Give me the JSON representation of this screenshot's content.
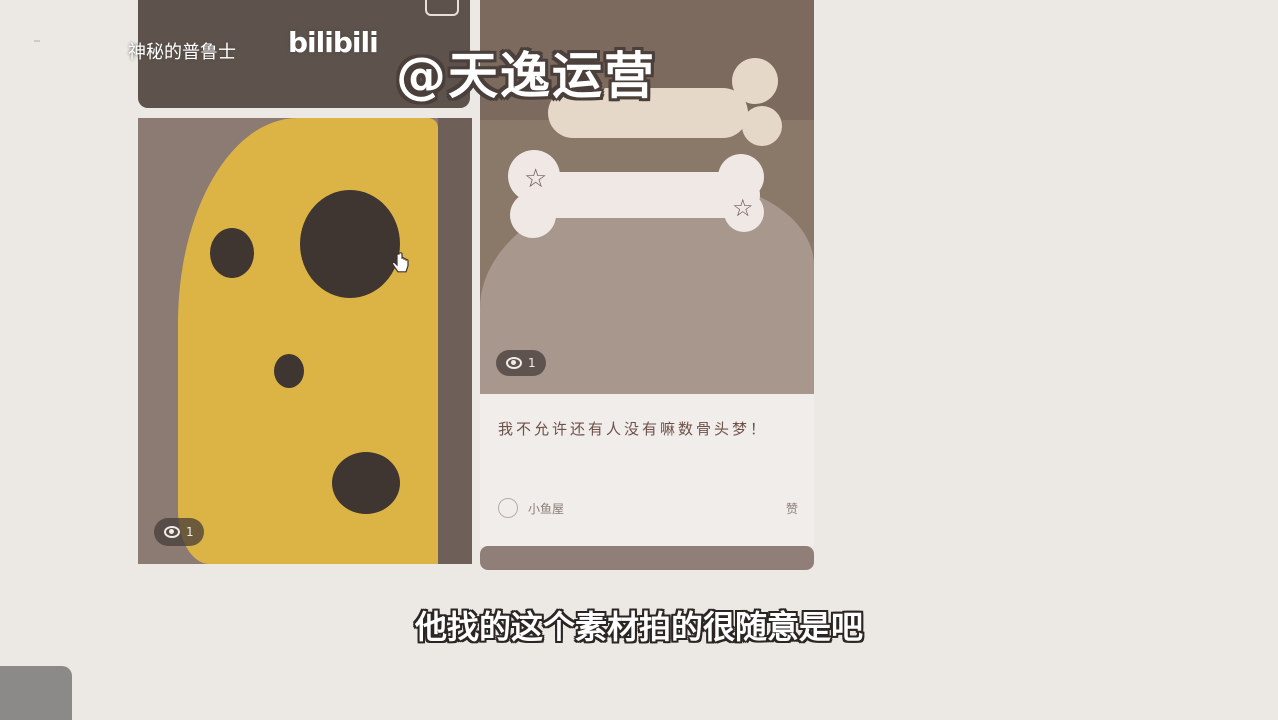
{
  "watermark": {
    "uploader_name": "神秘的普鲁士",
    "platform_logo": "bilibili",
    "channel_handle": "@天逸运营"
  },
  "subtitle": "他找的这个素材拍的很随意是吧",
  "feed": {
    "left_card": {
      "image": "cheese-toy-photo",
      "views": "1"
    },
    "right_card": {
      "image": "bone-toy-dog-photo",
      "views": "1",
      "title": "我不允许还有人没有嘛数骨头梦！",
      "author": "小鱼屋",
      "likes": "赞"
    }
  },
  "colors": {
    "background": "#ece9e5",
    "cheese_yellow": "#dcb445",
    "caption_text": "#6e5148"
  }
}
